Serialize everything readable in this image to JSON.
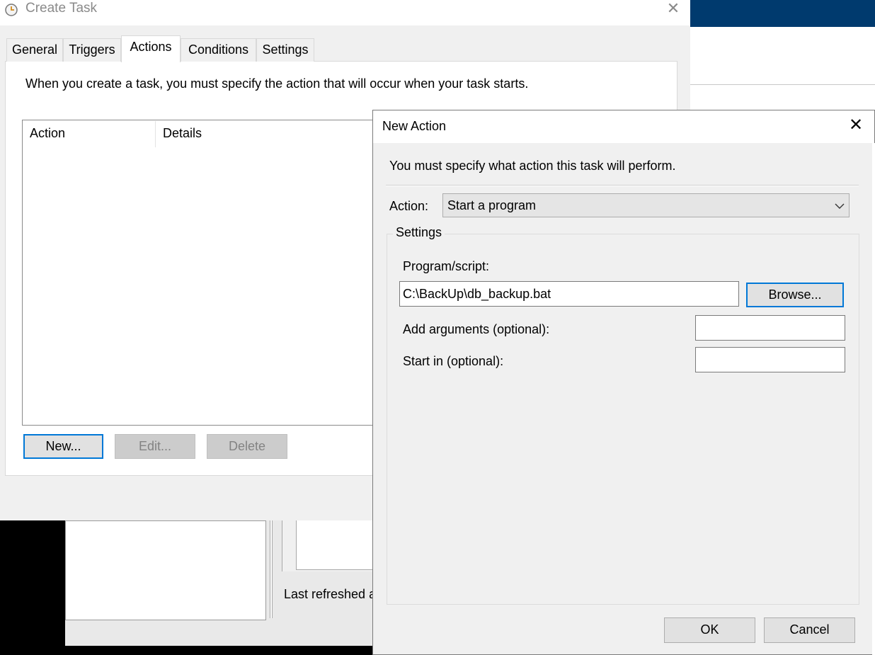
{
  "background": {
    "status_text": "Last refreshed a"
  },
  "create_task": {
    "title": "Create Task",
    "close_glyph": "✕",
    "icon": "clock-icon",
    "tabs": [
      {
        "label": "General"
      },
      {
        "label": "Triggers"
      },
      {
        "label": "Actions"
      },
      {
        "label": "Conditions"
      },
      {
        "label": "Settings"
      }
    ],
    "active_tab": "Actions",
    "intro_text": "When you create a task, you must specify the action that will occur when your task starts.",
    "columns": [
      "Action",
      "Details"
    ],
    "buttons": {
      "new": "New...",
      "edit": "Edit...",
      "delete": "Delete"
    }
  },
  "new_action": {
    "title": "New Action",
    "close_glyph": "✕",
    "intro_text": "You must specify what action this task will perform.",
    "action_label": "Action:",
    "action_value": "Start a program",
    "settings_label": "Settings",
    "program_label": "Program/script:",
    "program_value": "C:\\BackUp\\db_backup.bat",
    "browse_label": "Browse...",
    "args_label": "Add arguments (optional):",
    "args_value": "",
    "start_in_label": "Start in (optional):",
    "start_in_value": "",
    "ok_label": "OK",
    "cancel_label": "Cancel"
  },
  "colors": {
    "accent": "#0078d7",
    "host_header": "#003a6e",
    "dialog_bg": "#f0f0f0"
  }
}
